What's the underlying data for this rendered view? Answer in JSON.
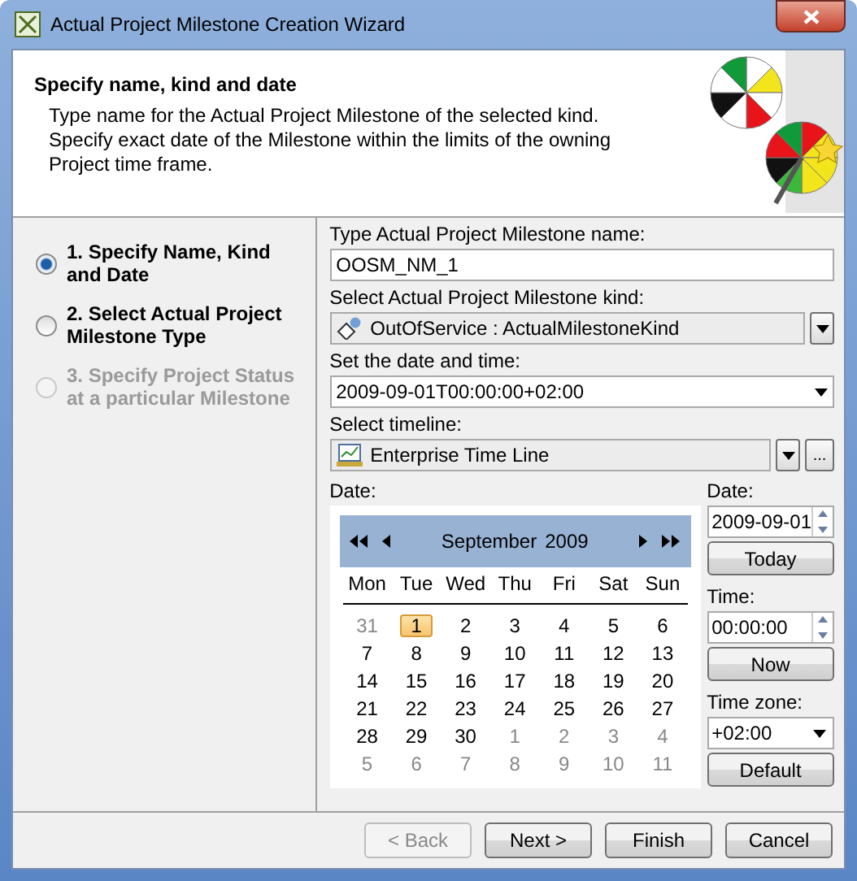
{
  "window": {
    "title": "Actual Project Milestone Creation Wizard"
  },
  "header": {
    "title": "Specify name, kind and date",
    "description": "Type name for the Actual Project Milestone of the selected kind. Specify exact date of the Milestone within the limits of the owning Project time frame."
  },
  "steps": [
    {
      "label": "1. Specify Name, Kind and Date",
      "selected": true,
      "disabled": false
    },
    {
      "label": "2. Select Actual Project Milestone Type",
      "selected": false,
      "disabled": false
    },
    {
      "label": "3. Specify Project Status at a particular Milestone",
      "selected": false,
      "disabled": true
    }
  ],
  "form": {
    "name_label": "Type Actual Project Milestone name:",
    "name_value": "OOSM_NM_1",
    "kind_label": "Select Actual Project Milestone kind:",
    "kind_value": "OutOfService : ActualMilestoneKind",
    "datetime_label": "Set the date and time:",
    "datetime_value": "2009-09-01T00:00:00+02:00",
    "timeline_label": "Select timeline:",
    "timeline_value": "Enterprise Time Line",
    "browse_button": "..."
  },
  "calendar": {
    "label": "Date:",
    "month": "September",
    "year": "2009",
    "weekdays": [
      "Mon",
      "Tue",
      "Wed",
      "Thu",
      "Fri",
      "Sat",
      "Sun"
    ],
    "weeks": [
      [
        {
          "day": "31",
          "current": false,
          "selected": false
        },
        {
          "day": "1",
          "current": true,
          "selected": true
        },
        {
          "day": "2",
          "current": true,
          "selected": false
        },
        {
          "day": "3",
          "current": true,
          "selected": false
        },
        {
          "day": "4",
          "current": true,
          "selected": false
        },
        {
          "day": "5",
          "current": true,
          "selected": false
        },
        {
          "day": "6",
          "current": true,
          "selected": false
        }
      ],
      [
        {
          "day": "7",
          "current": true,
          "selected": false
        },
        {
          "day": "8",
          "current": true,
          "selected": false
        },
        {
          "day": "9",
          "current": true,
          "selected": false
        },
        {
          "day": "10",
          "current": true,
          "selected": false
        },
        {
          "day": "11",
          "current": true,
          "selected": false
        },
        {
          "day": "12",
          "current": true,
          "selected": false
        },
        {
          "day": "13",
          "current": true,
          "selected": false
        }
      ],
      [
        {
          "day": "14",
          "current": true,
          "selected": false
        },
        {
          "day": "15",
          "current": true,
          "selected": false
        },
        {
          "day": "16",
          "current": true,
          "selected": false
        },
        {
          "day": "17",
          "current": true,
          "selected": false
        },
        {
          "day": "18",
          "current": true,
          "selected": false
        },
        {
          "day": "19",
          "current": true,
          "selected": false
        },
        {
          "day": "20",
          "current": true,
          "selected": false
        }
      ],
      [
        {
          "day": "21",
          "current": true,
          "selected": false
        },
        {
          "day": "22",
          "current": true,
          "selected": false
        },
        {
          "day": "23",
          "current": true,
          "selected": false
        },
        {
          "day": "24",
          "current": true,
          "selected": false
        },
        {
          "day": "25",
          "current": true,
          "selected": false
        },
        {
          "day": "26",
          "current": true,
          "selected": false
        },
        {
          "day": "27",
          "current": true,
          "selected": false
        }
      ],
      [
        {
          "day": "28",
          "current": true,
          "selected": false
        },
        {
          "day": "29",
          "current": true,
          "selected": false
        },
        {
          "day": "30",
          "current": true,
          "selected": false
        },
        {
          "day": "1",
          "current": false,
          "selected": false
        },
        {
          "day": "2",
          "current": false,
          "selected": false
        },
        {
          "day": "3",
          "current": false,
          "selected": false
        },
        {
          "day": "4",
          "current": false,
          "selected": false
        }
      ],
      [
        {
          "day": "5",
          "current": false,
          "selected": false
        },
        {
          "day": "6",
          "current": false,
          "selected": false
        },
        {
          "day": "7",
          "current": false,
          "selected": false
        },
        {
          "day": "8",
          "current": false,
          "selected": false
        },
        {
          "day": "9",
          "current": false,
          "selected": false
        },
        {
          "day": "10",
          "current": false,
          "selected": false
        },
        {
          "day": "11",
          "current": false,
          "selected": false
        }
      ]
    ]
  },
  "side": {
    "date_label": "Date:",
    "date_value": "2009-09-01",
    "today_button": "Today",
    "time_label": "Time:",
    "time_value": "00:00:00",
    "now_button": "Now",
    "zone_label": "Time zone:",
    "zone_value": "+02:00",
    "default_button": "Default"
  },
  "buttons": [
    {
      "label": "< Back",
      "disabled": true
    },
    {
      "label": "Next >",
      "disabled": false
    },
    {
      "label": "Finish",
      "disabled": false
    },
    {
      "label": "Cancel",
      "disabled": false
    }
  ]
}
